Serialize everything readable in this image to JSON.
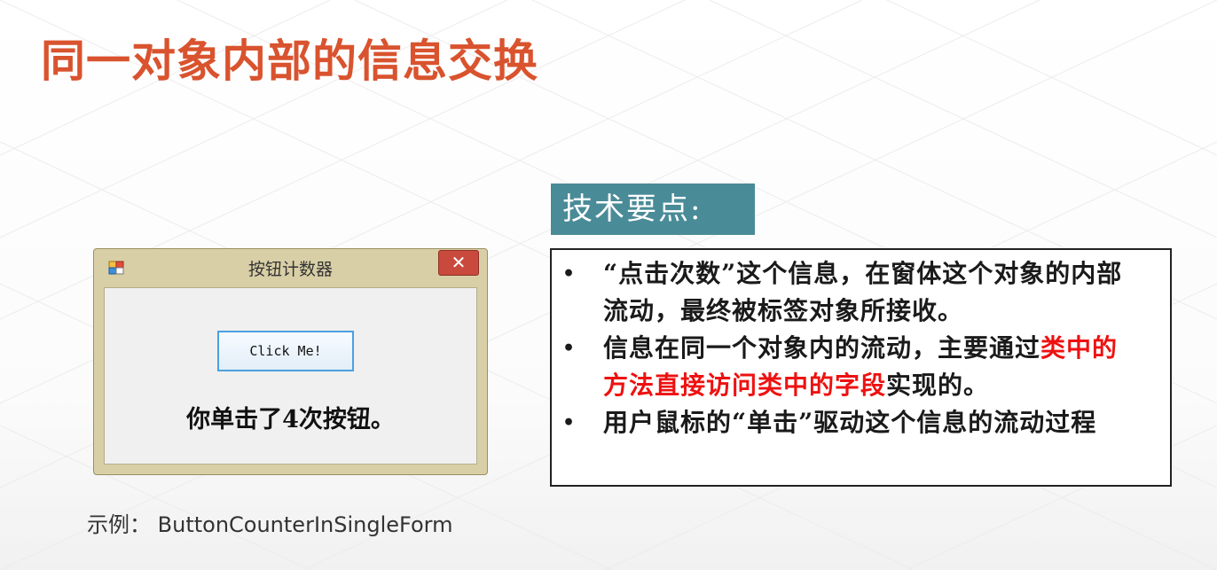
{
  "slide": {
    "title": "同一对象内部的信息交换",
    "caption_prefix": "示例：",
    "caption_name": "ButtonCounterInSingleForm"
  },
  "window": {
    "icon": "app-form-icon",
    "title": "按钮计数器",
    "close_glyph": "✕",
    "button_label": "Click Me!",
    "label_text": "你单击了4次按钮。"
  },
  "tech": {
    "header": "技术要点:",
    "bullet_glyph": "•",
    "items": [
      {
        "text": "“点击次数”这个信息，在窗体这个对象的内部流动，最终被标签对象所接收。"
      },
      {
        "text_before": "信息在同一个对象内的流动，主要通过",
        "text_highlight": "类中的方法直接访问类中的字段",
        "text_after": "实现的。"
      },
      {
        "text": "用户鼠标的“单击”驱动这个信息的流动过程"
      }
    ]
  },
  "colors": {
    "title": "#d9532e",
    "header_bg": "#4a8b98",
    "highlight": "#ee1111",
    "window_frame": "#d9cfa6",
    "close_button": "#c94a3d",
    "button_border": "#4ca0e0"
  }
}
